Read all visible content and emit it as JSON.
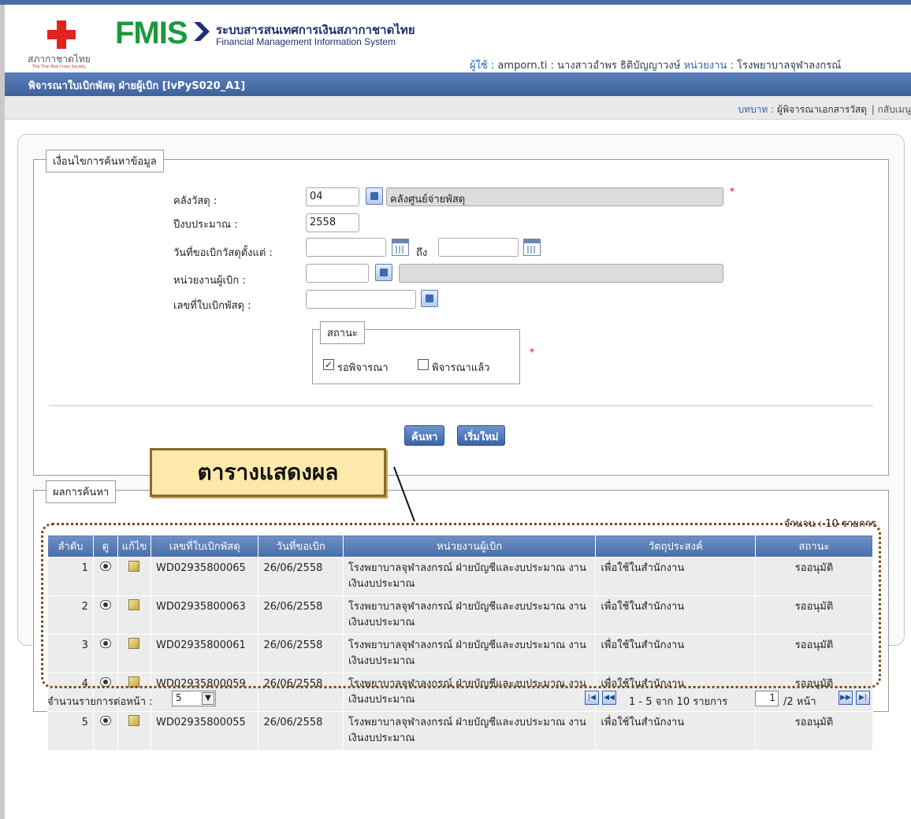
{
  "header": {
    "logo_th": "สภากาชาดไทย",
    "logo_en": "The Thai Red Cross Society",
    "app_name": "FMIS",
    "system_th": "ระบบสารสนเทศการเงินสภากาชาดไทย",
    "system_en": "Financial Management Information System",
    "user_label": "ผู้ใช้ :",
    "user_value": "amporn.ti : นางสาวอำพร ธิติบัญญาวงษ์",
    "unit_label": "หน่วยงาน :",
    "unit_value": "โรงพยาบาลจุฬาลงกรณ์"
  },
  "titlebar": {
    "title": "พิจารณาใบเบิกพัสดุ ฝ่ายผู้เบิก [IvPyS020_A1]"
  },
  "rolebar": {
    "role_label": "บทบาท :",
    "role_value": "ผู้พิจารณาเอกสารวัสดุ",
    "back": "| กลับเมนู"
  },
  "search": {
    "legend": "เงื่อนไขการค้นหาข้อมูล",
    "warehouse_label": "คลังวัสดุ :",
    "warehouse_code": "04",
    "warehouse_name": "คลังศูนย์จ่ายพัสดุ",
    "fiscal_year_label": "ปีงบประมาณ :",
    "fiscal_year": "2558",
    "date_from_label": "วันที่ขอเบิกวัสดุตั้งแต่ :",
    "date_to_label": "ถึง",
    "date_from": "",
    "date_to": "",
    "dept_label": "หน่วยงานผู้เบิก :",
    "dept_code": "",
    "dept_name": "",
    "doc_no_label": "เลขที่ใบเบิกพัสดุ :",
    "doc_no": "",
    "status_legend": "สถานะ",
    "status_pending": "รอพิจารณา",
    "status_done": "พิจารณาแล้ว",
    "required_mark": "*",
    "btn_search": "ค้นหา",
    "btn_reset": "เริ่มใหม่"
  },
  "callout": {
    "text": "ตารางแสดงผล"
  },
  "results": {
    "legend": "ผลการค้นหา",
    "count": "จำนวน : 10 รายการ",
    "columns": [
      "ลำดับ",
      "ดู",
      "แก้ไข",
      "เลขที่ใบเบิกพัสดุ",
      "วันที่ขอเบิก",
      "หน่วยงานผู้เบิก",
      "วัตถุประสงค์",
      "สถานะ"
    ],
    "rows": [
      {
        "no": "1",
        "doc": "WD02935800065",
        "date": "26/06/2558",
        "dept": "โรงพยาบาลจุฬาลงกรณ์ ฝ่ายบัญชีและงบประมาณ งานเงินงบประมาณ",
        "purpose": "เพื่อใช้ในสำนักงาน",
        "status": "รออนุมัติ"
      },
      {
        "no": "2",
        "doc": "WD02935800063",
        "date": "26/06/2558",
        "dept": "โรงพยาบาลจุฬาลงกรณ์ ฝ่ายบัญชีและงบประมาณ งานเงินงบประมาณ",
        "purpose": "เพื่อใช้ในสำนักงาน",
        "status": "รออนุมัติ"
      },
      {
        "no": "3",
        "doc": "WD02935800061",
        "date": "26/06/2558",
        "dept": "โรงพยาบาลจุฬาลงกรณ์ ฝ่ายบัญชีและงบประมาณ งานเงินงบประมาณ",
        "purpose": "เพื่อใช้ในสำนักงาน",
        "status": "รออนุมัติ"
      },
      {
        "no": "4",
        "doc": "WD02935800059",
        "date": "26/06/2558",
        "dept": "โรงพยาบาลจุฬาลงกรณ์ ฝ่ายบัญชีและงบประมาณ งานเงินงบประมาณ",
        "purpose": "เพื่อใช้ในสำนักงาน",
        "status": "รออนุมัติ"
      },
      {
        "no": "5",
        "doc": "WD02935800055",
        "date": "26/06/2558",
        "dept": "โรงพยาบาลจุฬาลงกรณ์ ฝ่ายบัญชีและงบประมาณ งานเงินงบประมาณ",
        "purpose": "เพื่อใช้ในสำนักงาน",
        "status": "รออนุมัติ"
      }
    ]
  },
  "pager": {
    "per_page_label": "จำนวนรายการต่อหน้า :",
    "per_page": "5",
    "range": "1 - 5 จาก 10 รายการ",
    "page": "1",
    "of_pages": "/2 หน้า"
  }
}
